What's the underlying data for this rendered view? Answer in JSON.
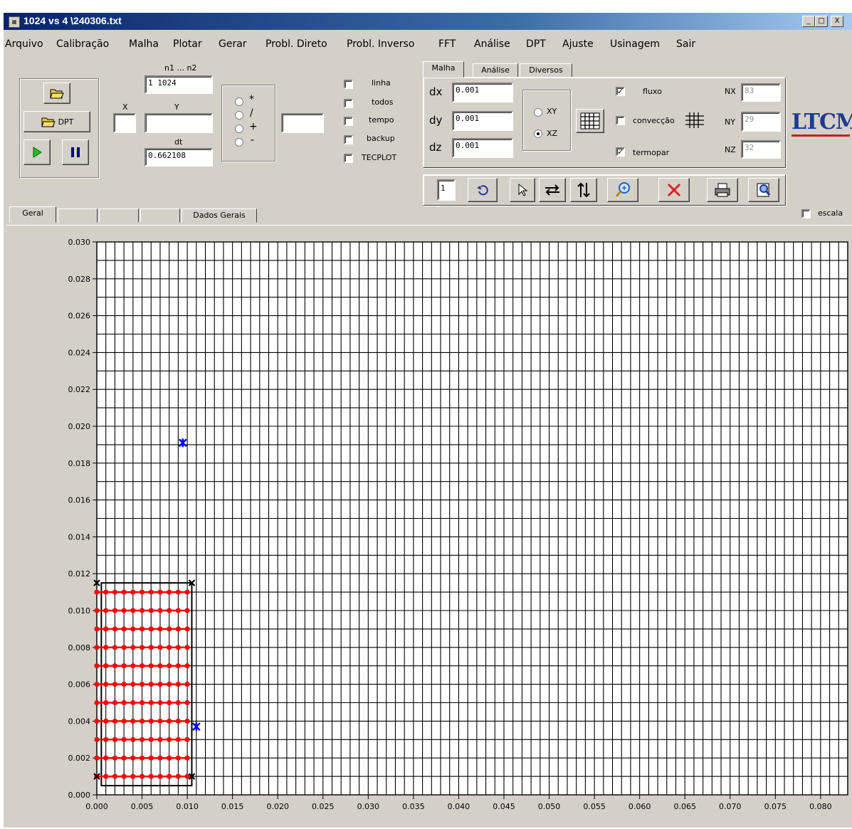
{
  "window": {
    "title": "1024 vs 4   \\240306.txt",
    "controls": [
      "_",
      "□",
      "X"
    ]
  },
  "menu": [
    "Arquivo",
    "Calibração",
    "Malha",
    "Plotar",
    "Gerar",
    "Probl. Direto",
    "Probl. Inverso",
    "FFT",
    "Análise",
    "DPT",
    "Ajuste",
    "Usinagem",
    "Sair"
  ],
  "left_panel": {
    "dpt_label": "DPT",
    "n_label": "n1 ... n2",
    "n_value": "1 1024",
    "x_label": "X",
    "x_value": "",
    "y_label": "Y",
    "y_value": "",
    "dt_label": "dt",
    "dt_value": "0.662108",
    "ops": [
      "*",
      "/",
      "+",
      "-"
    ],
    "op_value": ""
  },
  "checkboxes": [
    {
      "label": "linha",
      "checked": false
    },
    {
      "label": "todos",
      "checked": false
    },
    {
      "label": "tempo",
      "checked": false
    },
    {
      "label": "backup",
      "checked": false
    },
    {
      "label": "TECPLOT",
      "checked": false
    }
  ],
  "mesh_panel": {
    "tabs": [
      "Malha",
      "Análise",
      "Diversos"
    ],
    "dx_label": "dx",
    "dx": "0.001",
    "dy_label": "dy",
    "dy": "0.001",
    "dz_label": "dz",
    "dz": "0.001",
    "plane_options": [
      "XY",
      "XZ"
    ],
    "plane_selected": "XZ",
    "fluxo_label": "fluxo",
    "fluxo": true,
    "conveccao_label": "convecção",
    "conveccao": false,
    "termopar_label": "termopar",
    "termopar": true,
    "nx_label": "NX",
    "nx": "83",
    "ny_label": "NY",
    "ny": "29",
    "nz_label": "NZ",
    "nz": "32"
  },
  "toolbar": {
    "page_value": "1"
  },
  "logo": "LTCM",
  "view_tabs": [
    "Geral",
    "",
    "",
    "",
    "Dados Gerais"
  ],
  "escala_label": "escala",
  "colors": {
    "grid": "#000000",
    "heat_points": "#ff0000",
    "thermocouple": "#0000ff",
    "corner": "#000000"
  },
  "chart_data": {
    "type": "scatter",
    "xlim": [
      0.0,
      0.083
    ],
    "ylim": [
      0.0,
      0.03
    ],
    "x_step": 0.001,
    "y_step": 0.001,
    "grid": true,
    "x_tick_labels": [
      "0.000",
      "0.005",
      "0.010",
      "0.015",
      "0.020",
      "0.025",
      "0.030",
      "0.035",
      "0.040",
      "0.045",
      "0.050",
      "0.055",
      "0.060",
      "0.065",
      "0.070",
      "0.075",
      "0.080"
    ],
    "y_tick_labels": [
      "0.000",
      "0.002",
      "0.004",
      "0.006",
      "0.008",
      "0.010",
      "0.012",
      "0.014",
      "0.016",
      "0.018",
      "0.020",
      "0.022",
      "0.024",
      "0.026",
      "0.028",
      "0.030"
    ],
    "heat_flux_region": {
      "x": [
        0.0005,
        0.0105
      ],
      "y": [
        0.0005,
        0.0115
      ]
    },
    "heat_flux_points": {
      "x_min": 0.001,
      "x_max": 0.01,
      "x_step": 0.001,
      "y_min": 0.001,
      "y_max": 0.011,
      "y_step": 0.001
    },
    "corner_marks": [
      [
        0.0,
        0.001
      ],
      [
        0.0,
        0.0115
      ],
      [
        0.0105,
        0.001
      ],
      [
        0.0105,
        0.0115
      ]
    ],
    "thermocouples": [
      [
        0.0095,
        0.0191
      ],
      [
        0.011,
        0.0037
      ]
    ]
  }
}
